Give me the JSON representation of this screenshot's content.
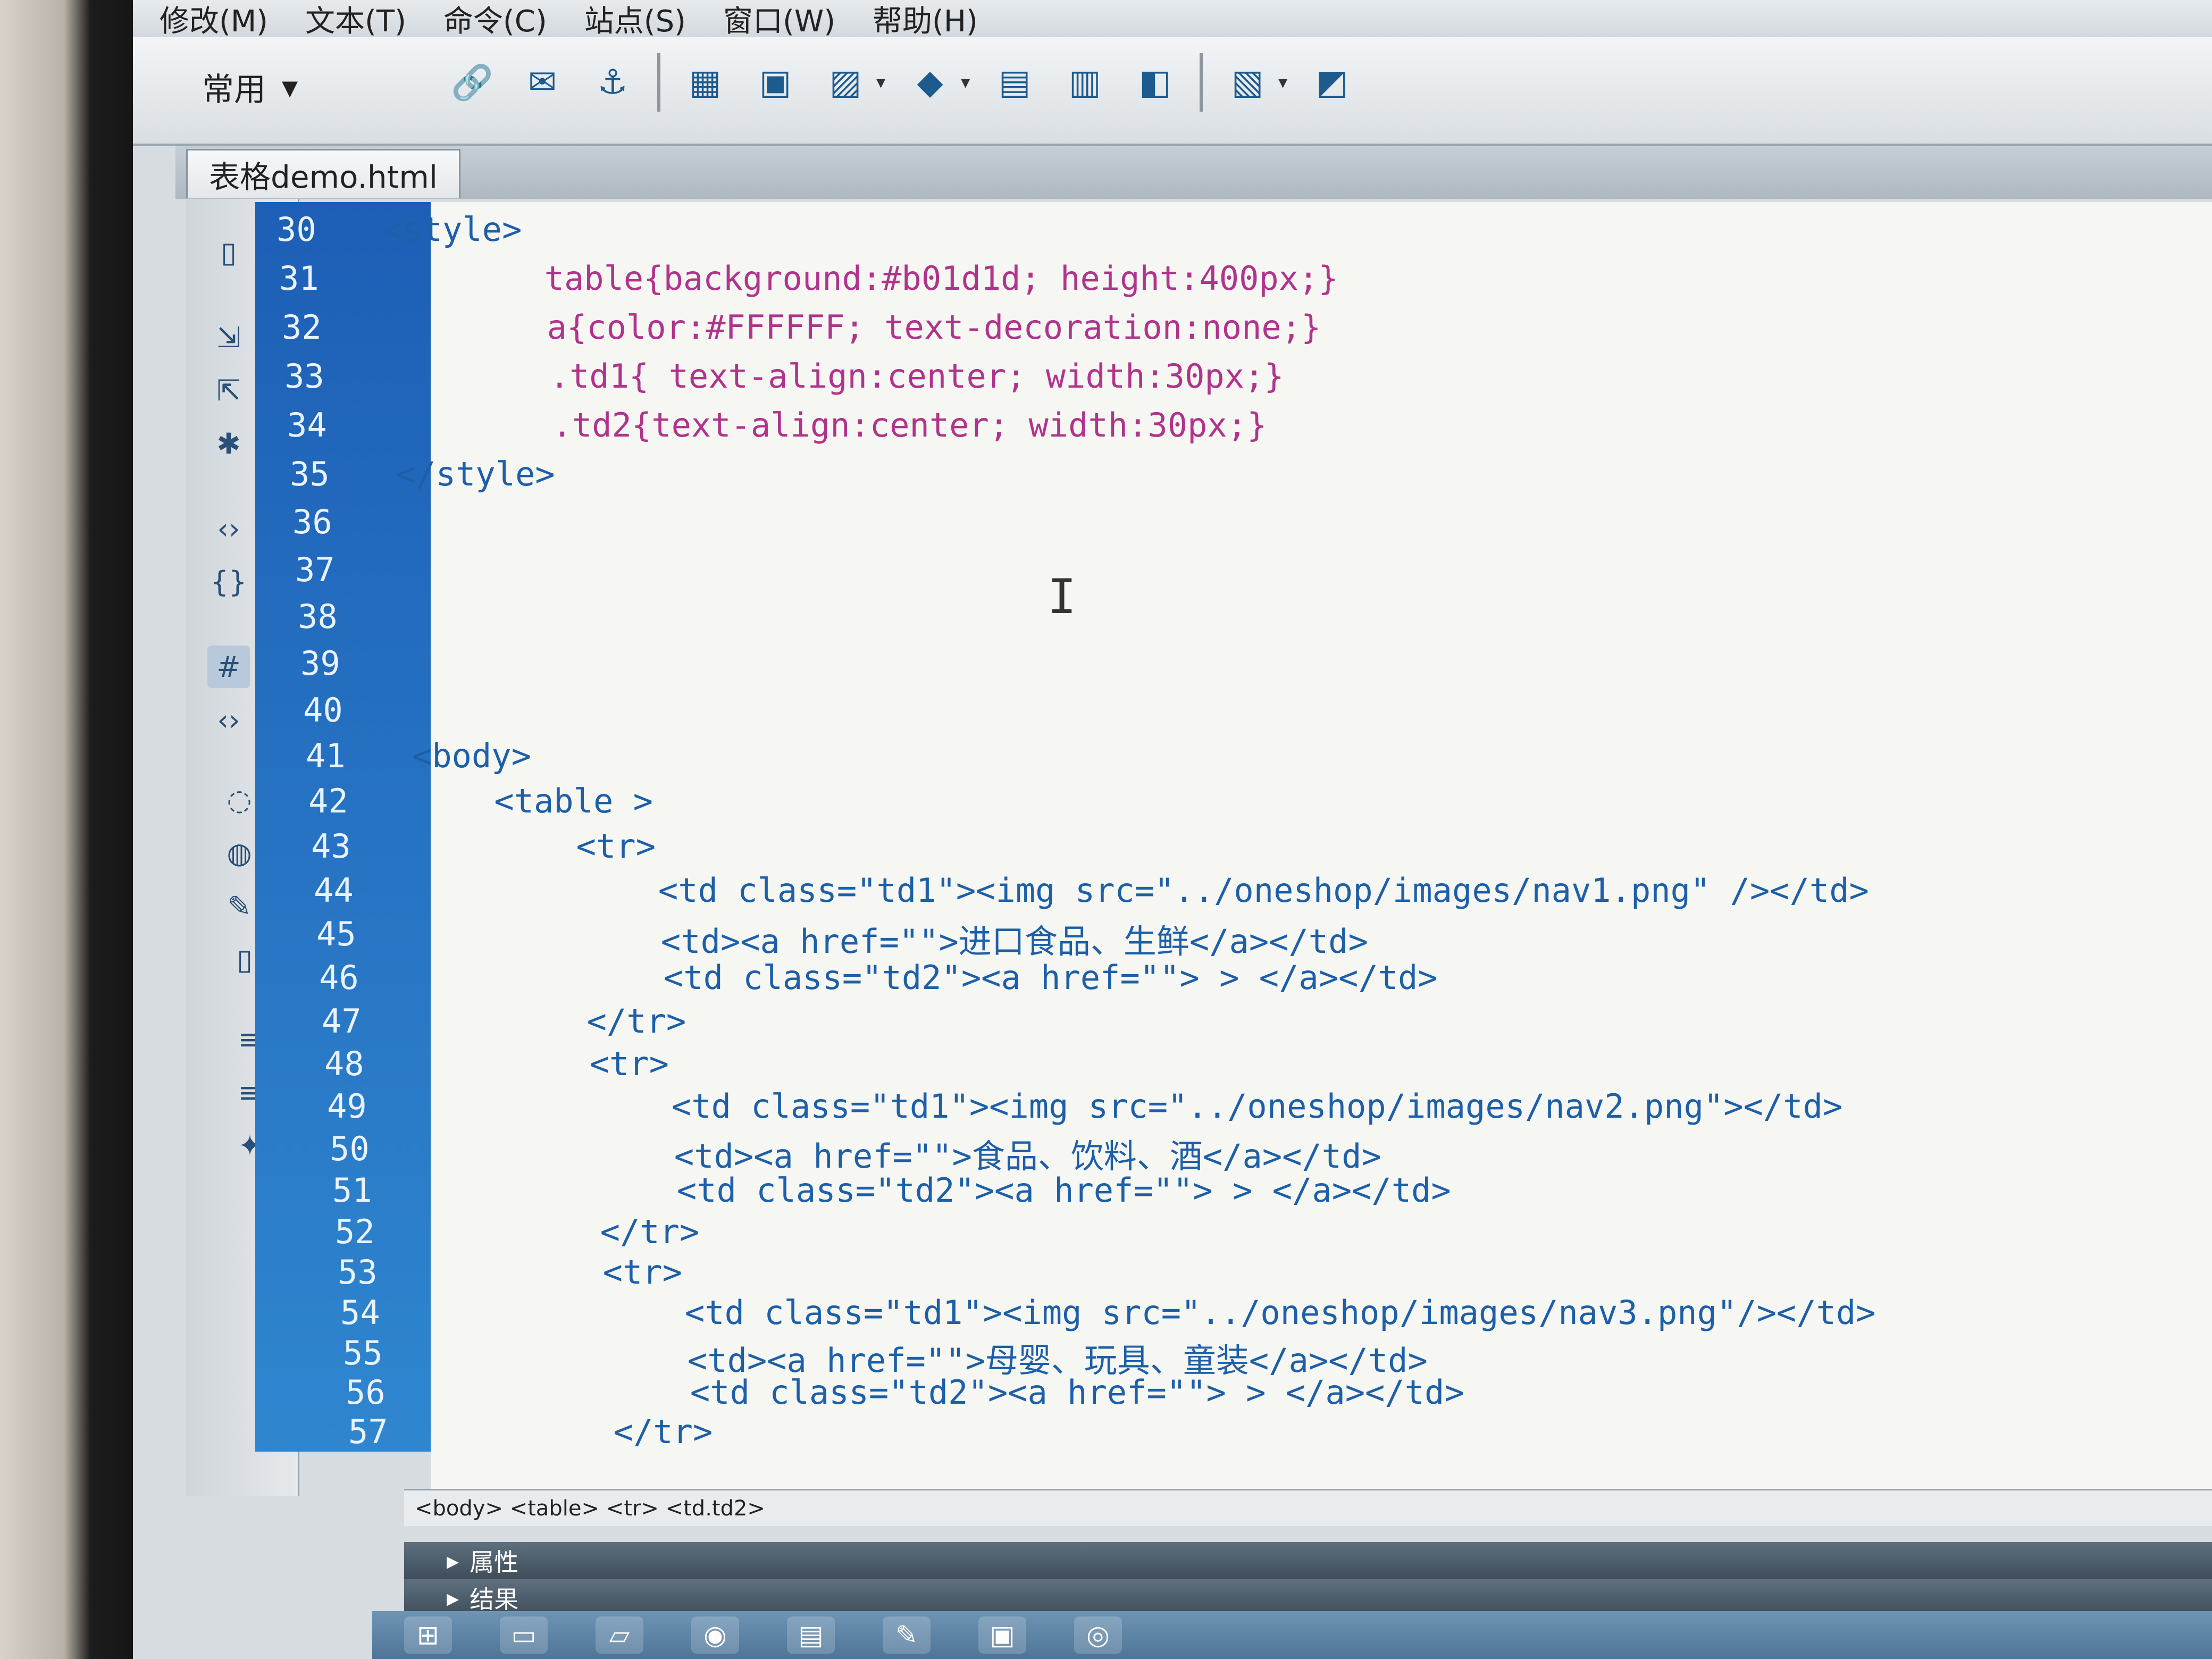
{
  "menu": [
    "修改(M)",
    "文本(T)",
    "命令(C)",
    "站点(S)",
    "窗口(W)",
    "帮助(H)"
  ],
  "toolbar": {
    "category": "常用",
    "icons": [
      "hyperlink-icon",
      "email-link-icon",
      "named-anchor-icon",
      "table-icon",
      "div-icon",
      "image-icon",
      "media-icon",
      "date-icon",
      "server-include-icon",
      "comment-icon",
      "template-icon",
      "tag-chooser-icon"
    ]
  },
  "document": {
    "tab_title": "表格demo.html"
  },
  "code_lines": [
    {
      "n": "30",
      "t": "<style>"
    },
    {
      "n": "31",
      "t": "        table{background:#b01d1d; height:400px;}"
    },
    {
      "n": "32",
      "t": "        a{color:#FFFFFF; text-decoration:none;}"
    },
    {
      "n": "33",
      "t": "        .td1{ text-align:center; width:30px;}"
    },
    {
      "n": "34",
      "t": "        .td2{text-align:center; width:30px;}"
    },
    {
      "n": "35",
      "t": "</style>"
    },
    {
      "n": "36",
      "t": ""
    },
    {
      "n": "37",
      "t": ""
    },
    {
      "n": "38",
      "t": ""
    },
    {
      "n": "39",
      "t": ""
    },
    {
      "n": "40",
      "t": ""
    },
    {
      "n": "41",
      "t": "<body>"
    },
    {
      "n": "42",
      "t": "    <table >"
    },
    {
      "n": "43",
      "t": "        <tr>"
    },
    {
      "n": "44",
      "t": "            <td class=\"td1\"><img src=\"../oneshop/images/nav1.png\" /></td>"
    },
    {
      "n": "45",
      "t": "            <td><a href=\"\">进口食品、生鲜</a></td>"
    },
    {
      "n": "46",
      "t": "            <td class=\"td2\"><a href=\"\"> > </a></td>"
    },
    {
      "n": "47",
      "t": "        </tr>"
    },
    {
      "n": "48",
      "t": "        <tr>"
    },
    {
      "n": "49",
      "t": "            <td class=\"td1\"><img src=\"../oneshop/images/nav2.png\"></td>"
    },
    {
      "n": "50",
      "t": "            <td><a href=\"\">食品、饮料、酒</a></td>"
    },
    {
      "n": "51",
      "t": "            <td class=\"td2\"><a href=\"\"> > </a></td>"
    },
    {
      "n": "52",
      "t": "        </tr>"
    },
    {
      "n": "53",
      "t": "        <tr>"
    },
    {
      "n": "54",
      "t": "            <td class=\"td1\"><img src=\"../oneshop/images/nav3.png\"/></td>"
    },
    {
      "n": "55",
      "t": "            <td><a href=\"\">母婴、玩具、童装</a></td>"
    },
    {
      "n": "56",
      "t": "            <td class=\"td2\"><a href=\"\"> > </a></td>"
    },
    {
      "n": "57",
      "t": "        </tr>"
    }
  ],
  "status": {
    "tag_path": "<body> <table> <tr> <td.td2>"
  },
  "panels": {
    "properties": "属性",
    "results": "结果"
  },
  "taskbar": {
    "icons": [
      "start-icon",
      "file-explorer-icon",
      "files-icon",
      "chrome-icon",
      "notepad-icon",
      "paint-icon",
      "photo-viewer-icon",
      "dreamweaver-icon"
    ]
  },
  "colors": {
    "gutter": "#2f7fd0",
    "selector": "#b0338c",
    "tag": "#1d5fa8"
  }
}
